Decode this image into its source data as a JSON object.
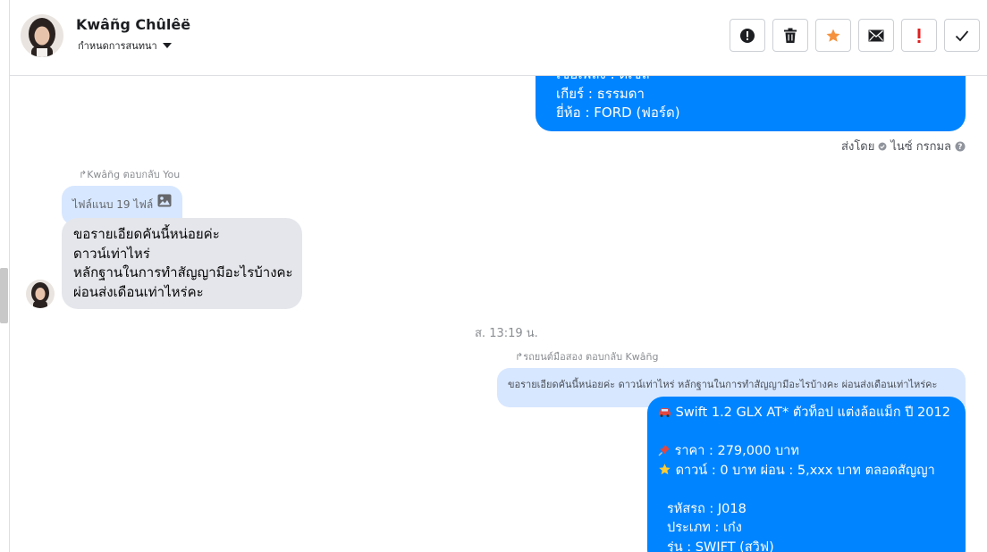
{
  "header": {
    "contact_name": "Kwâñg Chûlêë",
    "assign_label": "กำหนดการสนทนา"
  },
  "actions": [
    {
      "icon": "exclamation-circle-icon",
      "color": "#1c1e21"
    },
    {
      "icon": "trash-icon",
      "color": "#1c1e21"
    },
    {
      "icon": "star-icon",
      "color": "#f5923e"
    },
    {
      "icon": "envelope-icon",
      "color": "#1c1e21"
    },
    {
      "icon": "exclamation-icon",
      "color": "#e02020"
    },
    {
      "icon": "checkmark-icon",
      "color": "#1c1e21"
    }
  ],
  "messages": {
    "top_bubble": {
      "line1": "เชื้อเพลิง : ดีเซล",
      "line2": "เกียร์ : ธรรมดา",
      "line3": "ยี่ห้อ : FORD (ฟอร์ด)"
    },
    "sent_by": {
      "prefix": "ส่งโดย",
      "name": "ไนซ์ กรกมล"
    },
    "reply1_label": "Kwâñg ตอบกลับ You",
    "file_chip": "ไฟล์แนบ 19 ไฟล์",
    "customer_bubble": {
      "line1": "ขอรายเอียดคันนี้หน่อยค่ะ",
      "line2": "ดาวน์เท่าไหร่",
      "line3": "หลักฐานในการทำสัญญามีอะไรบ้างคะ",
      "line4": "ผ่อนส่งเดือนเท่าไหร่คะ"
    },
    "timestamp": "ส. 13:19 น.",
    "reply2_label": "รถยนต์มือสอง ตอบกลับ Kwâñg",
    "quote": "ขอรายเอียดคันนี้หน่อยค่ะ ดาวน์เท่าไหร่ หลักฐานในการทำสัญญามีอะไรบ้างคะ ผ่อนส่งเดือนเท่าไหร่คะ",
    "bottom_bubble": {
      "title": "Swift 1.2 GLX AT* ตัวท็อป แต่งล้อแม็ก ปี 2012",
      "price": "ราคา : 279,000 บาท",
      "down": "ดาวน์ : 0 บาท ผ่อน : 5,xxx บาท ตลอดสัญญา",
      "code": "รหัสรถ : J018",
      "type": "ประเภท : เก๋ง",
      "model": "รุ่น : SWIFT (สวิฟ)"
    }
  },
  "colors": {
    "messenger_blue": "#0084ff",
    "quote_bg": "#d7e7ff",
    "incoming_bg": "#e4e6eb",
    "star": "#f5923e",
    "alert_red": "#e02020"
  }
}
